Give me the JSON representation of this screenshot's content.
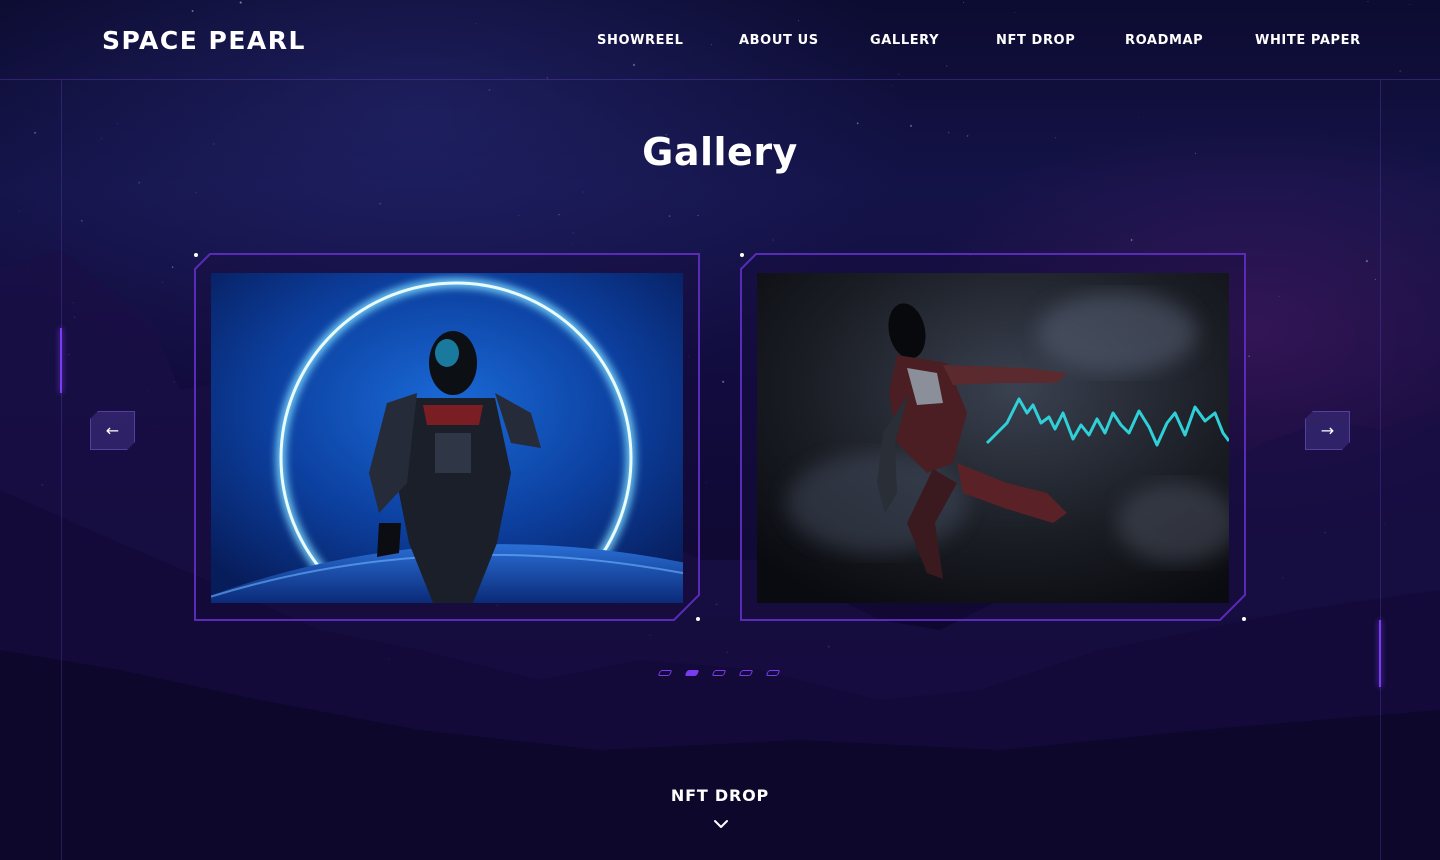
{
  "header": {
    "logo": "SPACE PEARL",
    "nav": [
      "SHOWREEL",
      "ABOUT US",
      "GALLERY",
      "NFT DROP",
      "ROADMAP",
      "WHITE PAPER"
    ]
  },
  "gallery": {
    "title": "Gallery",
    "cards": [
      {
        "image": "armored-astronaut-portal",
        "theme": "blue"
      },
      {
        "image": "armored-astronaut-jumping",
        "theme": "dark-red"
      }
    ],
    "pagination": {
      "count": 5,
      "active_index": 1
    }
  },
  "next_section": {
    "label": "NFT DROP",
    "icon": "chevron-down-icon"
  },
  "arrows": {
    "prev_icon": "arrow-left-icon",
    "next_icon": "arrow-right-icon",
    "prev": "←",
    "next": "→"
  },
  "colors": {
    "background": "#0c0a2e",
    "accent": "#7a3cf0",
    "text": "#ffffff"
  }
}
